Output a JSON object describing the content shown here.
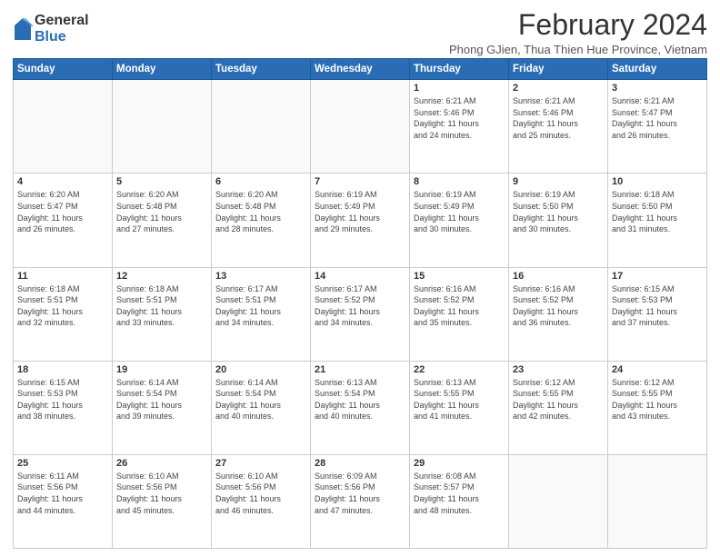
{
  "logo": {
    "general": "General",
    "blue": "Blue"
  },
  "title": "February 2024",
  "subtitle": "Phong GJien, Thua Thien Hue Province, Vietnam",
  "headers": [
    "Sunday",
    "Monday",
    "Tuesday",
    "Wednesday",
    "Thursday",
    "Friday",
    "Saturday"
  ],
  "weeks": [
    [
      {
        "day": "",
        "info": ""
      },
      {
        "day": "",
        "info": ""
      },
      {
        "day": "",
        "info": ""
      },
      {
        "day": "",
        "info": ""
      },
      {
        "day": "1",
        "info": "Sunrise: 6:21 AM\nSunset: 5:46 PM\nDaylight: 11 hours\nand 24 minutes."
      },
      {
        "day": "2",
        "info": "Sunrise: 6:21 AM\nSunset: 5:46 PM\nDaylight: 11 hours\nand 25 minutes."
      },
      {
        "day": "3",
        "info": "Sunrise: 6:21 AM\nSunset: 5:47 PM\nDaylight: 11 hours\nand 26 minutes."
      }
    ],
    [
      {
        "day": "4",
        "info": "Sunrise: 6:20 AM\nSunset: 5:47 PM\nDaylight: 11 hours\nand 26 minutes."
      },
      {
        "day": "5",
        "info": "Sunrise: 6:20 AM\nSunset: 5:48 PM\nDaylight: 11 hours\nand 27 minutes."
      },
      {
        "day": "6",
        "info": "Sunrise: 6:20 AM\nSunset: 5:48 PM\nDaylight: 11 hours\nand 28 minutes."
      },
      {
        "day": "7",
        "info": "Sunrise: 6:19 AM\nSunset: 5:49 PM\nDaylight: 11 hours\nand 29 minutes."
      },
      {
        "day": "8",
        "info": "Sunrise: 6:19 AM\nSunset: 5:49 PM\nDaylight: 11 hours\nand 30 minutes."
      },
      {
        "day": "9",
        "info": "Sunrise: 6:19 AM\nSunset: 5:50 PM\nDaylight: 11 hours\nand 30 minutes."
      },
      {
        "day": "10",
        "info": "Sunrise: 6:18 AM\nSunset: 5:50 PM\nDaylight: 11 hours\nand 31 minutes."
      }
    ],
    [
      {
        "day": "11",
        "info": "Sunrise: 6:18 AM\nSunset: 5:51 PM\nDaylight: 11 hours\nand 32 minutes."
      },
      {
        "day": "12",
        "info": "Sunrise: 6:18 AM\nSunset: 5:51 PM\nDaylight: 11 hours\nand 33 minutes."
      },
      {
        "day": "13",
        "info": "Sunrise: 6:17 AM\nSunset: 5:51 PM\nDaylight: 11 hours\nand 34 minutes."
      },
      {
        "day": "14",
        "info": "Sunrise: 6:17 AM\nSunset: 5:52 PM\nDaylight: 11 hours\nand 34 minutes."
      },
      {
        "day": "15",
        "info": "Sunrise: 6:16 AM\nSunset: 5:52 PM\nDaylight: 11 hours\nand 35 minutes."
      },
      {
        "day": "16",
        "info": "Sunrise: 6:16 AM\nSunset: 5:52 PM\nDaylight: 11 hours\nand 36 minutes."
      },
      {
        "day": "17",
        "info": "Sunrise: 6:15 AM\nSunset: 5:53 PM\nDaylight: 11 hours\nand 37 minutes."
      }
    ],
    [
      {
        "day": "18",
        "info": "Sunrise: 6:15 AM\nSunset: 5:53 PM\nDaylight: 11 hours\nand 38 minutes."
      },
      {
        "day": "19",
        "info": "Sunrise: 6:14 AM\nSunset: 5:54 PM\nDaylight: 11 hours\nand 39 minutes."
      },
      {
        "day": "20",
        "info": "Sunrise: 6:14 AM\nSunset: 5:54 PM\nDaylight: 11 hours\nand 40 minutes."
      },
      {
        "day": "21",
        "info": "Sunrise: 6:13 AM\nSunset: 5:54 PM\nDaylight: 11 hours\nand 40 minutes."
      },
      {
        "day": "22",
        "info": "Sunrise: 6:13 AM\nSunset: 5:55 PM\nDaylight: 11 hours\nand 41 minutes."
      },
      {
        "day": "23",
        "info": "Sunrise: 6:12 AM\nSunset: 5:55 PM\nDaylight: 11 hours\nand 42 minutes."
      },
      {
        "day": "24",
        "info": "Sunrise: 6:12 AM\nSunset: 5:55 PM\nDaylight: 11 hours\nand 43 minutes."
      }
    ],
    [
      {
        "day": "25",
        "info": "Sunrise: 6:11 AM\nSunset: 5:56 PM\nDaylight: 11 hours\nand 44 minutes."
      },
      {
        "day": "26",
        "info": "Sunrise: 6:10 AM\nSunset: 5:56 PM\nDaylight: 11 hours\nand 45 minutes."
      },
      {
        "day": "27",
        "info": "Sunrise: 6:10 AM\nSunset: 5:56 PM\nDaylight: 11 hours\nand 46 minutes."
      },
      {
        "day": "28",
        "info": "Sunrise: 6:09 AM\nSunset: 5:56 PM\nDaylight: 11 hours\nand 47 minutes."
      },
      {
        "day": "29",
        "info": "Sunrise: 6:08 AM\nSunset: 5:57 PM\nDaylight: 11 hours\nand 48 minutes."
      },
      {
        "day": "",
        "info": ""
      },
      {
        "day": "",
        "info": ""
      }
    ]
  ]
}
